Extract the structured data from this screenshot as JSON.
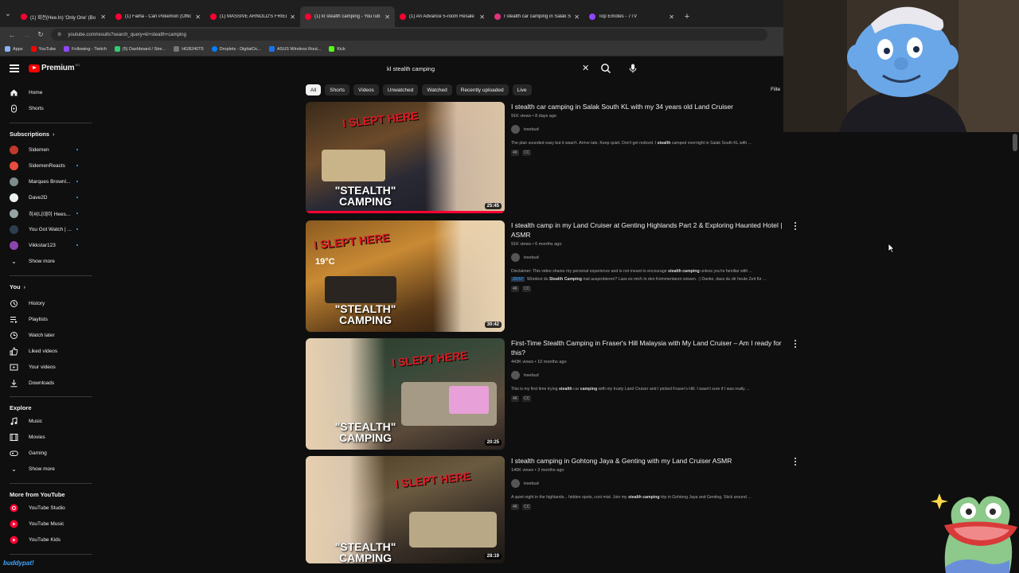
{
  "browser": {
    "tabs": [
      {
        "title": "(1) 회전(Hee.In) 'Only One' (Bo",
        "active": false,
        "favicon": "youtube"
      },
      {
        "title": "(1) Faiha - Cari Pokemon (Offic",
        "active": false,
        "favicon": "youtube"
      },
      {
        "title": "(1) MASSIVE ARNOLD'S FRIED",
        "active": false,
        "favicon": "youtube"
      },
      {
        "title": "(1) kl stealth camping - YouTub",
        "active": true,
        "favicon": "youtube"
      },
      {
        "title": "(1) An Advance 5-room Resale",
        "active": false,
        "favicon": "youtube"
      },
      {
        "title": "I stealth car camping in Salak S",
        "active": false,
        "favicon": "youtube"
      },
      {
        "title": "Top Emotes - 7TV",
        "active": false,
        "favicon": "7tv"
      }
    ],
    "url": "youtube.com/results?search_query=kl+stealth+camping",
    "bookmarks": [
      {
        "label": "Apps",
        "color": "#8ab4f8"
      },
      {
        "label": "YouTube",
        "color": "#ff0000"
      },
      {
        "label": "Following - Twitch",
        "color": "#9146ff"
      },
      {
        "label": "(5) Dashboard / Stre...",
        "color": "#2ecc71"
      },
      {
        "label": "HGB240T5",
        "color": "#777777"
      },
      {
        "label": "Droplets - DigitalOc...",
        "color": "#0080ff"
      },
      {
        "label": "ASUS Wireless Rout...",
        "color": "#1a73e8"
      },
      {
        "label": "Kick",
        "color": "#53fc18"
      }
    ]
  },
  "masthead": {
    "logo_text": "Premium",
    "logo_superscript": "SG",
    "search_value": "kl stealth camping"
  },
  "sidebar": {
    "main": [
      {
        "label": "Home",
        "icon": "home-icon"
      },
      {
        "label": "Shorts",
        "icon": "shorts-icon"
      }
    ],
    "subscriptions_heading": "Subscriptions",
    "subscriptions": [
      {
        "label": "Sidemen",
        "color": "#c0392b"
      },
      {
        "label": "SidemenReacts",
        "color": "#e74c3c"
      },
      {
        "label": "Marques Brownl...",
        "color": "#7f8c8d"
      },
      {
        "label": "Dave2D",
        "color": "#ecf0f1"
      },
      {
        "label": "히씨니데이 Hees...",
        "color": "#95a5a6"
      },
      {
        "label": "You Got Watch | ...",
        "color": "#2c3e50"
      },
      {
        "label": "Vikkstar123",
        "color": "#8e44ad"
      }
    ],
    "show_more": "Show more",
    "you_heading": "You",
    "you": [
      {
        "label": "History",
        "icon": "history-icon"
      },
      {
        "label": "Playlists",
        "icon": "playlists-icon"
      },
      {
        "label": "Watch later",
        "icon": "watch-later-icon"
      },
      {
        "label": "Liked videos",
        "icon": "liked-icon"
      },
      {
        "label": "Your videos",
        "icon": "your-videos-icon"
      },
      {
        "label": "Downloads",
        "icon": "download-icon"
      }
    ],
    "explore_heading": "Explore",
    "explore": [
      {
        "label": "Music",
        "icon": "music-icon"
      },
      {
        "label": "Movies",
        "icon": "movies-icon"
      },
      {
        "label": "Gaming",
        "icon": "gaming-icon"
      }
    ],
    "explore_show_more": "Show more",
    "more_heading": "More from YouTube",
    "more": [
      {
        "label": "YouTube Studio"
      },
      {
        "label": "YouTube Music"
      },
      {
        "label": "YouTube Kids"
      }
    ]
  },
  "filters": {
    "chips": [
      "All",
      "Shorts",
      "Videos",
      "Unwatched",
      "Watched",
      "Recently uploaded",
      "Live"
    ],
    "active_index": 0,
    "filters_label": "Filte"
  },
  "results": [
    {
      "title": "I stealth car camping in Salak South KL with my 34 years old Land Cruiser",
      "views": "91K views",
      "age": "8 days ago",
      "channel": "treebud",
      "snippet_pre": "The plan sounded easy but it wasn't. Arrive late. Keep quiet. Don't get noticed. I ",
      "snippet_bold": "stealth",
      "snippet_post": " camped overnight in Salak South KL with ...",
      "badges": [
        "4K",
        "CC"
      ],
      "duration": "25:45",
      "overlay": "\"STEALTH\" CAMPING",
      "slept_text": "I SLEPT HERE",
      "watched_progress": 1.0
    },
    {
      "title": "I stealth camp in my Land Cruiser at Genting Highlands Part 2 & Exploring Haunted Hotel | ASMR",
      "views": "91K views",
      "age": "6 months ago",
      "channel": "treebud",
      "snippet_pre": "Disclaimer: This video shares my personal experience and is not meant to encourage ",
      "snippet_bold": "stealth camping",
      "snippet_post": " unless you're familiar with ...",
      "chapter_time": "29:57",
      "chapter_pre": "Würdest du ",
      "chapter_bold": "Stealth Camping",
      "chapter_post": " mal ausprobieren? Lass es mich in den Kommentaren wissen. :) Danke, dass du dir heute Zeit für ...",
      "badges": [
        "4K",
        "CC"
      ],
      "duration": "30:42",
      "overlay": "\"STEALTH\" CAMPING",
      "slept_text": "I SLEPT HERE",
      "temp_text": "19°C"
    },
    {
      "title": "First-Time Stealth Camping in Fraser's Hill Malaysia with My Land Cruiser – Am I ready for this?",
      "views": "443K views",
      "age": "10 months ago",
      "channel": "treebud",
      "snippet_pre": "This is my first time trying ",
      "snippet_bold": "stealth",
      "snippet_mid": " car ",
      "snippet_bold2": "camping",
      "snippet_post": " with my trusty Land Cruiser and I picked Fraser's Hill. I wasn't sure if I was really ...",
      "badges": [
        "4K",
        "CC"
      ],
      "duration": "20:25",
      "overlay": "\"STEALTH\" CAMPING",
      "slept_text": "I SLEPT HERE"
    },
    {
      "title": "I stealth camping in Gohtong Jaya & Genting with my Land Cruiser ASMR",
      "views": "146K views",
      "age": "3 months ago",
      "channel": "treebud",
      "snippet_pre": "A quiet night in the highlands... hidden spots, cool mist. Join my ",
      "snippet_bold": "stealth camping",
      "snippet_post": " trip in Gohtong Jaya and Genting. Stick around ...",
      "badges": [
        "4K",
        "CC"
      ],
      "duration": "28:19",
      "overlay": "\"STEALTH\" CAMPING",
      "slept_text": "I SLEPT HERE"
    }
  ],
  "overlay": {
    "streamer_tag": "buddypat!"
  },
  "colors": {
    "background": "#0f0f0f",
    "brand_red": "#ff0000",
    "text_primary": "#f1f1f1",
    "text_secondary": "#aaaaaa",
    "link_blue": "#3ea6ff"
  }
}
